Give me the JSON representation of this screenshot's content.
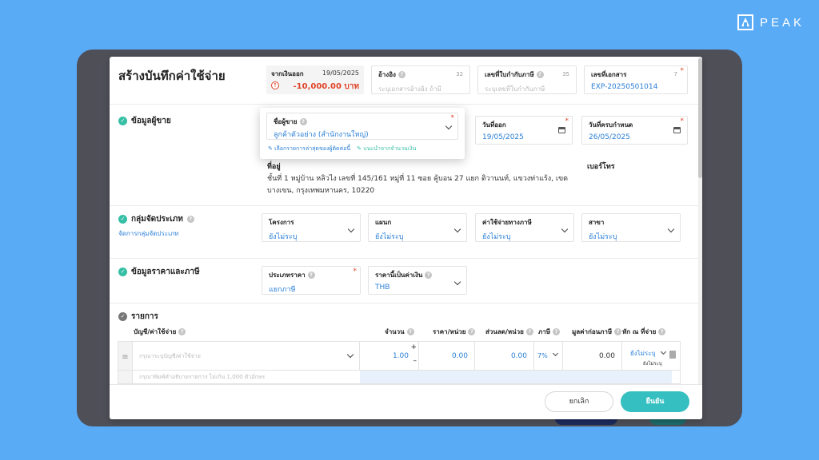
{
  "brand": {
    "name": "PEAK"
  },
  "title": "สร้างบันทึกค่าใช้จ่าย",
  "header": {
    "payment": {
      "label": "จากเงินออก",
      "date": "19/05/2025",
      "amount": "-10,000.00 บาท"
    },
    "reference": {
      "label": "อ้างอิง",
      "count": "32",
      "placeholder": "ระบุเอกสารอ้างอิง ถ้ามี"
    },
    "tax_invoice": {
      "label": "เลขที่ใบกำกับภาษี",
      "count": "35",
      "placeholder": "ระบุเลขที่ใบกำกับภาษี"
    },
    "doc_no": {
      "label": "เลขที่เอกสาร",
      "count": "7",
      "value": "EXP-20250501014"
    }
  },
  "vendor": {
    "section_label": "ข้อมูลผู้ขาย",
    "name_label": "ชื่อผู้ขาย",
    "name_value": "ลูกค้าตัวอย่าง (สำนักงานใหญ่)",
    "link_choose": "เลือกรายการล่าสุดของผู้ติดต่อนี้",
    "link_recommend": "แนะนำจากจำนวนเงิน",
    "issue_date_label": "วันที่ออก",
    "issue_date": "19/05/2025",
    "due_date_label": "วันที่ครบกำหนด",
    "due_date": "26/05/2025",
    "address_label": "ที่อยู่",
    "address": "ชั้นที่ 1 หมู่บ้าน หลิวไง เลขที่ 145/161 หมู่ที่ 11 ซอย คู้บอน 27 แยก ติวานนท์, แขวงท่าแร้ง, เขตบางเขน, กรุงเทพมหานคร, 10220",
    "phone_label": "เบอร์โทร"
  },
  "category": {
    "section_label": "กลุ่มจัดประเภท",
    "manage_link": "จัดการกลุ่มจัดประเภท",
    "fields": [
      {
        "label": "โครงการ",
        "value": "ยังไม่ระบุ"
      },
      {
        "label": "แผนก",
        "value": "ยังไม่ระบุ"
      },
      {
        "label": "ค่าใช้จ่ายทางภาษี",
        "value": "ยังไม่ระบุ"
      },
      {
        "label": "สาขา",
        "value": "ยังไม่ระบุ"
      }
    ]
  },
  "pricing": {
    "section_label": "ข้อมูลราคาและภาษี",
    "price_type_label": "ประเภทราคา",
    "price_type": "แยกภาษี",
    "currency_label": "ราคานี้เป็นค่าเงิน",
    "currency": "THB"
  },
  "items": {
    "section_label": "รายการ",
    "columns": {
      "account": "บัญชี/ค่าใช้จ่าย",
      "qty": "จำนวน",
      "price": "ราคา/หน่วย",
      "discount": "ส่วนลด/หน่วย",
      "vat": "ภาษี",
      "pretax": "มูลค่าก่อนภาษี",
      "wht": "หัก ณ ที่จ่าย"
    },
    "row": {
      "account_placeholder": "กรุณาระบุบัญชี/ค่าใช้จ่าย",
      "qty": "1.00",
      "plus": "+",
      "minus": "–",
      "price": "0.00",
      "discount": "0.00",
      "vat": "7%",
      "pretax": "0.00",
      "wht": "ยังไม่ระบุ",
      "wht_sub": "ยังไม่ระบุ",
      "desc_placeholder": "กรุณาพิมพ์คำอธิบายรายการ ไม่เกิน 1,000 ตัวอักษร"
    }
  },
  "footer": {
    "cancel": "ยกเลิก",
    "confirm": "ยืนยัน"
  }
}
